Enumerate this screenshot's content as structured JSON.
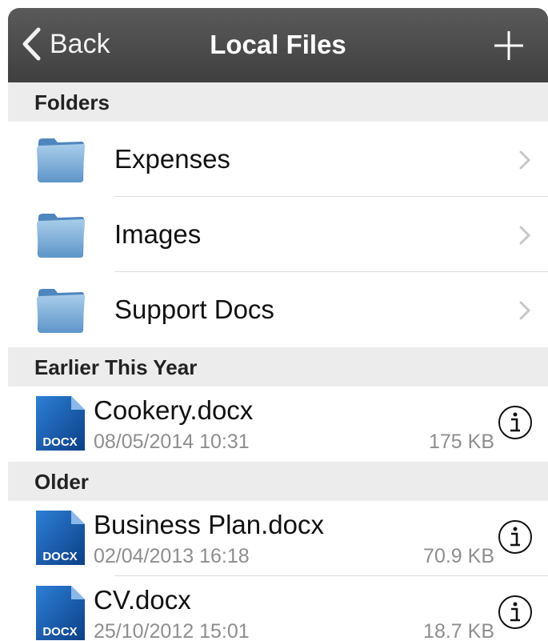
{
  "navbar": {
    "back_label": "Back",
    "title": "Local Files",
    "add_icon": "plus-icon",
    "back_icon": "chevron-left-icon"
  },
  "sections": {
    "folders_header": "Folders",
    "earlier_header": "Earlier This Year",
    "older_header": "Older"
  },
  "folders": [
    {
      "name": "Expenses"
    },
    {
      "name": "Images"
    },
    {
      "name": "Support Docs"
    }
  ],
  "files_earlier": [
    {
      "name": "Cookery.docx",
      "date": "08/05/2014 10:31",
      "size": "175 KB",
      "type_label": "DOCX"
    }
  ],
  "files_older": [
    {
      "name": "Business Plan.docx",
      "date": "02/04/2013 16:18",
      "size": "70.9 KB",
      "type_label": "DOCX"
    },
    {
      "name": "CV.docx",
      "date": "25/10/2012 15:01",
      "size": "18.7 KB",
      "type_label": "DOCX"
    }
  ],
  "colors": {
    "navbar_top": "#5a5a5a",
    "navbar_bottom": "#3f3f3f",
    "section_bg": "#ececec",
    "docx_blue": "#1a5fb4",
    "secondary_text": "#8e8e8e"
  }
}
